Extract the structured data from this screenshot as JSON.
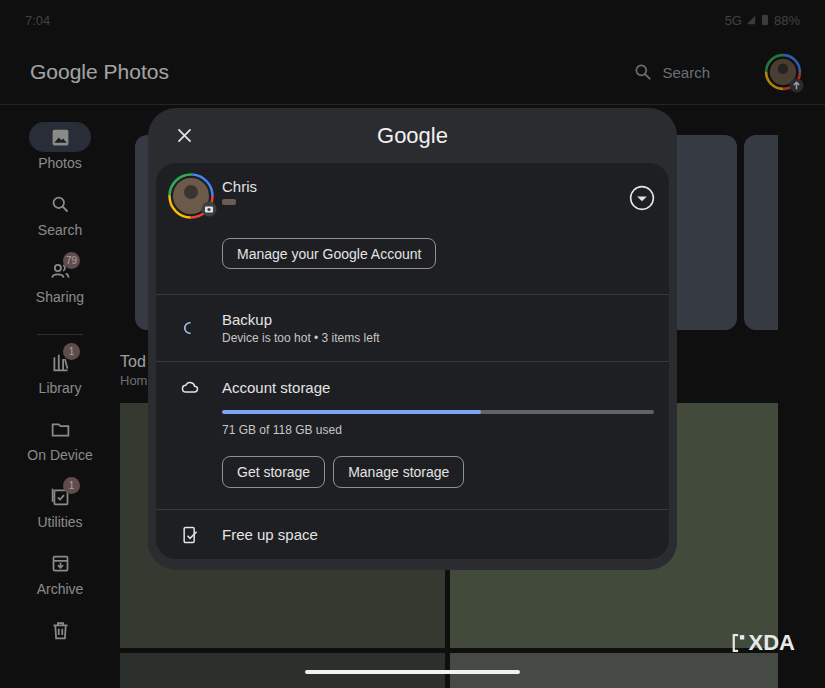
{
  "status_bar": {
    "time": "7:04",
    "network": "5G",
    "battery": "88%"
  },
  "app": {
    "title": "Google Photos",
    "search_label": "Search"
  },
  "sidebar": {
    "groups": [
      [
        {
          "label": "Photos",
          "selected": true
        },
        {
          "label": "Search",
          "selected": false
        },
        {
          "label": "Sharing",
          "badge": "79",
          "selected": false
        }
      ],
      [
        {
          "label": "Library",
          "badge": "1",
          "selected": false
        },
        {
          "label": "On Device",
          "selected": false
        },
        {
          "label": "Utilities",
          "badge": "1",
          "selected": false
        },
        {
          "label": "Archive",
          "selected": false
        },
        {
          "selected": false
        }
      ]
    ]
  },
  "main": {
    "section_title": "Tod",
    "section_subtitle": "Hom"
  },
  "dialog": {
    "title": "Google",
    "account": {
      "name": "Chris"
    },
    "manage_button": "Manage your Google Account",
    "backup": {
      "title": "Backup",
      "status": "Device is too hot • 3 items left"
    },
    "storage": {
      "title": "Account storage",
      "level": 0.6,
      "reading": "71 GB of 118 GB used",
      "buttons": [
        "Get storage",
        "Manage storage"
      ]
    },
    "free_up": {
      "label": "Free up space"
    }
  },
  "watermark": "XDA"
}
